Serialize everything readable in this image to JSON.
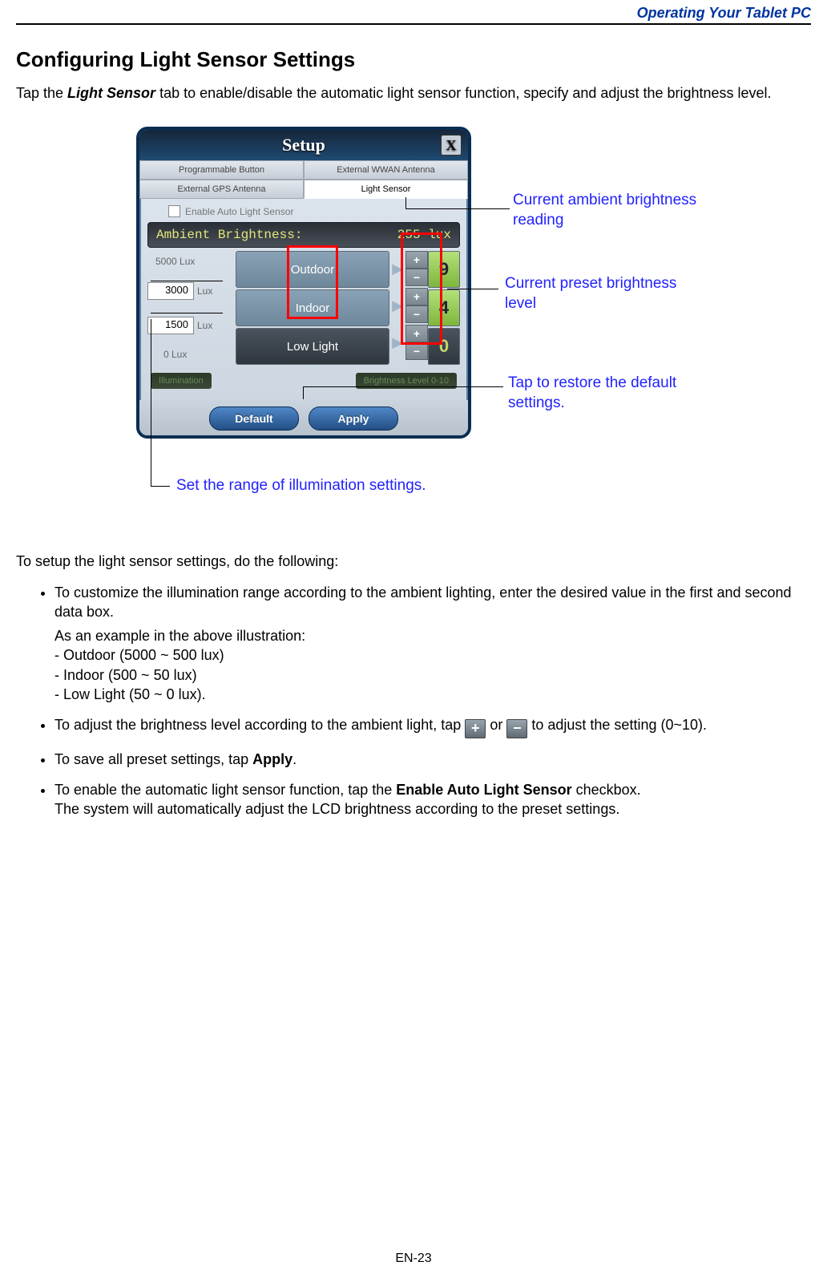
{
  "runhead": "Operating Your Tablet PC",
  "section_title": "Configuring Light Sensor Settings",
  "intro_pre": "Tap the ",
  "intro_tab": "Light Sensor",
  "intro_post": " tab to enable/disable the automatic light sensor function, specify and adjust the brightness level.",
  "window": {
    "title": "Setup",
    "close": "X",
    "tabs_row1": [
      "Programmable Button",
      "External WWAN Antenna"
    ],
    "tabs_row2": [
      "External GPS Antenna",
      "Light Sensor"
    ],
    "checkbox_label": "Enable  Auto Light Sensor",
    "ambient_label": "Ambient Brightness:",
    "ambient_value": "255 lux",
    "lux_top": "5000 Lux",
    "lux_box1": "3000",
    "lux_box2": "1500",
    "lux_unit": "Lux",
    "lux_bottom": "0 Lux",
    "modes": [
      "Outdoor",
      "Indoor",
      "Low Light"
    ],
    "values": [
      "9",
      "4",
      "0"
    ],
    "footer_left": "Illumination",
    "footer_right": "Brightness Level 0-10",
    "btn_default": "Default",
    "btn_apply": "Apply"
  },
  "callouts": {
    "ambient": "Current ambient brightness reading",
    "preset": "Current preset brightness level",
    "default": "Tap to restore the default settings.",
    "range": "Set the range of illumination settings."
  },
  "body_intro": "To setup the light sensor settings, do the following:",
  "bullets": {
    "b1_l1": "To customize the illumination range according to the ambient lighting, enter the desired value in the first and second data box.",
    "b1_l2": "As an example in the above illustration:",
    "b1_l3": "- Outdoor (5000 ~ 500 lux)",
    "b1_l4": "- Indoor (500 ~ 50 lux)",
    "b1_l5": "- Low Light (50 ~ 0 lux).",
    "b2_pre": "To adjust the brightness level according to the ambient light, tap ",
    "b2_mid": " or ",
    "b2_post": " to adjust the setting (0~10).",
    "b3_pre": "To save all preset settings, tap ",
    "b3_bold": "Apply",
    "b3_post": ".",
    "b4_pre": "To enable the automatic light sensor function, tap the ",
    "b4_bold": "Enable Auto Light Sensor",
    "b4_mid": " checkbox.",
    "b4_l2": "The system will automatically adjust the LCD brightness according to the preset settings."
  },
  "page_number": "EN-23"
}
